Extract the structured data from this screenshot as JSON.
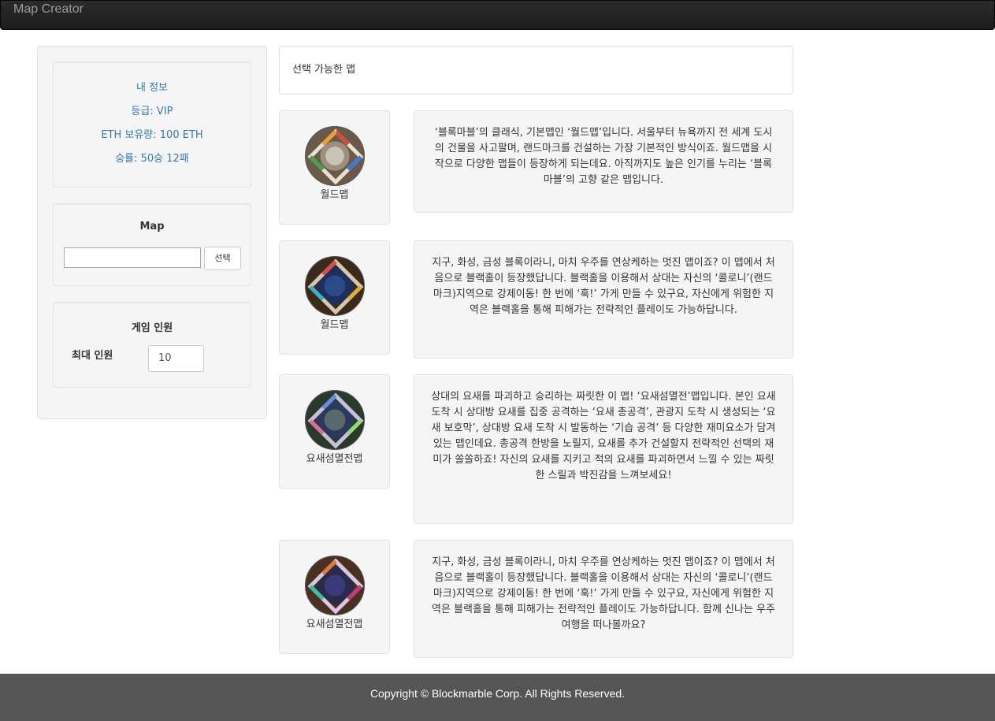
{
  "navbar": {
    "brand": "Map Creator"
  },
  "profile": {
    "title": "내 정보",
    "grade": "등급: VIP",
    "eth": "ETH 보유량: 100 ETH",
    "record": "승률: 50승 12패"
  },
  "map_panel": {
    "heading": "Map",
    "input_value": "",
    "select_label": "선택"
  },
  "players_panel": {
    "heading": "게임 인원",
    "max_label": "최대 인원",
    "max_value": "10"
  },
  "main": {
    "header": "선택 가능한 맵"
  },
  "maps": [
    {
      "name": "월드맵",
      "description": "‘블록마블’의 클래식, 기본맵인 ‘월드맵’입니다. 서울부터 뉴욕까지 전 세계 도시의 건물을 사고팔며, 랜드마크를 건설하는 가장 기본적인 방식이죠. 월드맵을 시작으로 다양한 맵들이 등장하게 되는데요. 아직까지도 높은 인기를 누리는 ‘블록마블’의 고향 같은 맵입니다."
    },
    {
      "name": "월드맵",
      "description": "지구, 화성, 금성 블록이라니, 마치 우주를 연상케하는 멋진 맵이죠? 이 맵에서 처음으로 블랙홀이 등장했답니다. 블랙홀을 이용해서 상대는 자신의 ‘콜로니’(랜드마크)지역으로 강제이동! 한 번에 ‘훅!’ 가게 만들 수 있구요, 자신에게 위험한 지역은 블랙홀을 통해 피해가는 전략적인 플레이도 가능하답니다."
    },
    {
      "name": "요새섬멸전맵",
      "description": "상대의 요새를 파괴하고 승리하는 짜릿한 이 맵! ‘요새섬멸전’맵입니다. 본인 요새 도착 시 상대방 요새를 집중 공격하는 ‘요새 총공격’, 관광지 도착 시 생성되는 ‘요새 보호막’, 상대방 요새 도착 시 발동하는 ‘기습 공격’ 등 다양한 재미요소가 담겨있는 맵인데요. 총공격 한방을 노릴지, 요새를 추가 건설할지 전략적인 선택의 재미가 쏠쏠하죠! 자신의 요새를 지키고 적의 요새를 파괴하면서 느낄 수 있는 짜릿한 스릴과 박진감을 느껴보세요!"
    },
    {
      "name": "요새섬멸전맵",
      "description": "지구, 화성, 금성 블록이라니, 마치 우주를 연상케하는 멋진 맵이죠? 이 맵에서 처음으로 블랙홀이 등장했답니다. 블랙홀을 이용해서 상대는 자신의 ‘콜로니’(랜드마크)지역으로 강제이동! 한 번에 ‘훅!’ 가게 만들 수 있구요, 자신에게 위험한 지역은 블랙홀을 통해 피해가는 전략적인 플레이도 가능하답니다. 함께 신나는 우주여행을 떠나볼까요?"
    }
  ],
  "footer": {
    "copyright": "Copyright © Blockmarble Corp. All Rights Reserved."
  }
}
